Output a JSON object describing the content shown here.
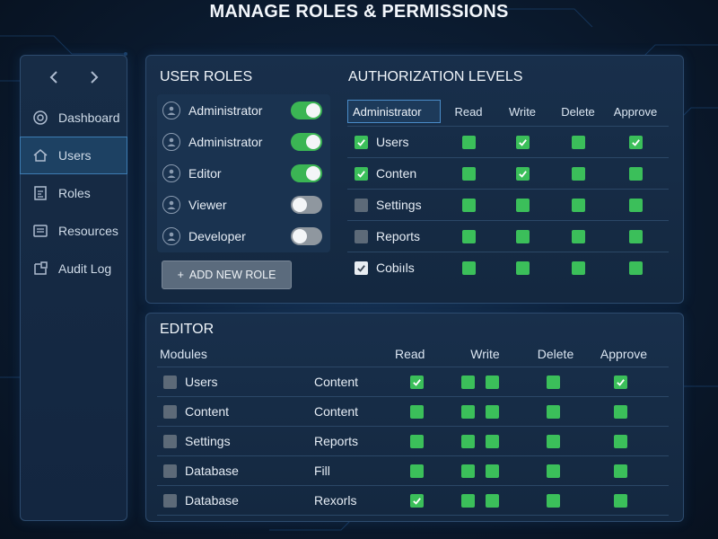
{
  "page": {
    "title": "MANAGE ROLES & PERMISSIONS"
  },
  "sidebar": {
    "back_icon": "chevron-left-icon",
    "forward_icon": "chevron-right-icon",
    "items": [
      {
        "label": "Dashboard",
        "icon": "dashboard-icon",
        "active": false
      },
      {
        "label": "Users",
        "icon": "home-icon",
        "active": true
      },
      {
        "label": "Roles",
        "icon": "roles-icon",
        "active": false
      },
      {
        "label": "Resources",
        "icon": "document-icon",
        "active": false
      },
      {
        "label": "Audit Log",
        "icon": "audit-log-icon",
        "active": false
      }
    ]
  },
  "user_roles": {
    "title": "USER ROLES",
    "roles": [
      {
        "name": "Administrator",
        "enabled": true
      },
      {
        "name": "Administrator",
        "enabled": true
      },
      {
        "name": "Editor",
        "enabled": true
      },
      {
        "name": "Viewer",
        "enabled": false
      },
      {
        "name": "Developer",
        "enabled": false
      }
    ],
    "add_button": {
      "icon": "+",
      "label": "ADD NEW ROLE"
    }
  },
  "authorization": {
    "title": "AUTHORIZATION LEVELS",
    "selected_role": "Administrator",
    "columns": [
      "Read",
      "Write",
      "Delete",
      "Approve"
    ],
    "rows": [
      {
        "resource": "Users",
        "row_state": "checked-green",
        "perms": [
          "green",
          "green-check",
          "green",
          "green-check"
        ]
      },
      {
        "resource": "Conten",
        "row_state": "checked-green",
        "perms": [
          "green",
          "green-check",
          "green",
          "green"
        ]
      },
      {
        "resource": "Settings",
        "row_state": "gray",
        "perms": [
          "green",
          "green",
          "green",
          "green"
        ]
      },
      {
        "resource": "Reports",
        "row_state": "gray",
        "perms": [
          "green",
          "green",
          "green",
          "green"
        ]
      },
      {
        "resource": "Cobiıls",
        "row_state": "plain-check",
        "perms": [
          "green",
          "green",
          "green",
          "green"
        ]
      }
    ]
  },
  "editor": {
    "title": "EDITOR",
    "columns": {
      "modules": "Modules",
      "read": "Read",
      "write": "Write",
      "delete": "Delete",
      "approve": "Approve"
    },
    "rows": [
      {
        "module": "Users",
        "sub": "Content",
        "read": "green-check",
        "write": [
          "green",
          "green"
        ],
        "delete": "green",
        "approve": "green-check"
      },
      {
        "module": "Content",
        "sub": "Content",
        "read": "green",
        "write": [
          "green",
          "green"
        ],
        "delete": "green",
        "approve": "green"
      },
      {
        "module": "Settings",
        "sub": "Reports",
        "read": "green",
        "write": [
          "green",
          "green"
        ],
        "delete": "green",
        "approve": "green"
      },
      {
        "module": "Database",
        "sub": "Fill",
        "read": "green",
        "write": [
          "green",
          "green"
        ],
        "delete": "green",
        "approve": "green"
      },
      {
        "module": "Database",
        "sub": "Rexorls",
        "read": "green-check",
        "write": [
          "green",
          "green"
        ],
        "delete": "green",
        "approve": "green"
      }
    ]
  },
  "colors": {
    "background": "#0c1d33",
    "panel": "#182f4b",
    "accent_green": "#3bbf5a",
    "toggle_off": "#8f979f",
    "active_nav": "#1d4163"
  }
}
